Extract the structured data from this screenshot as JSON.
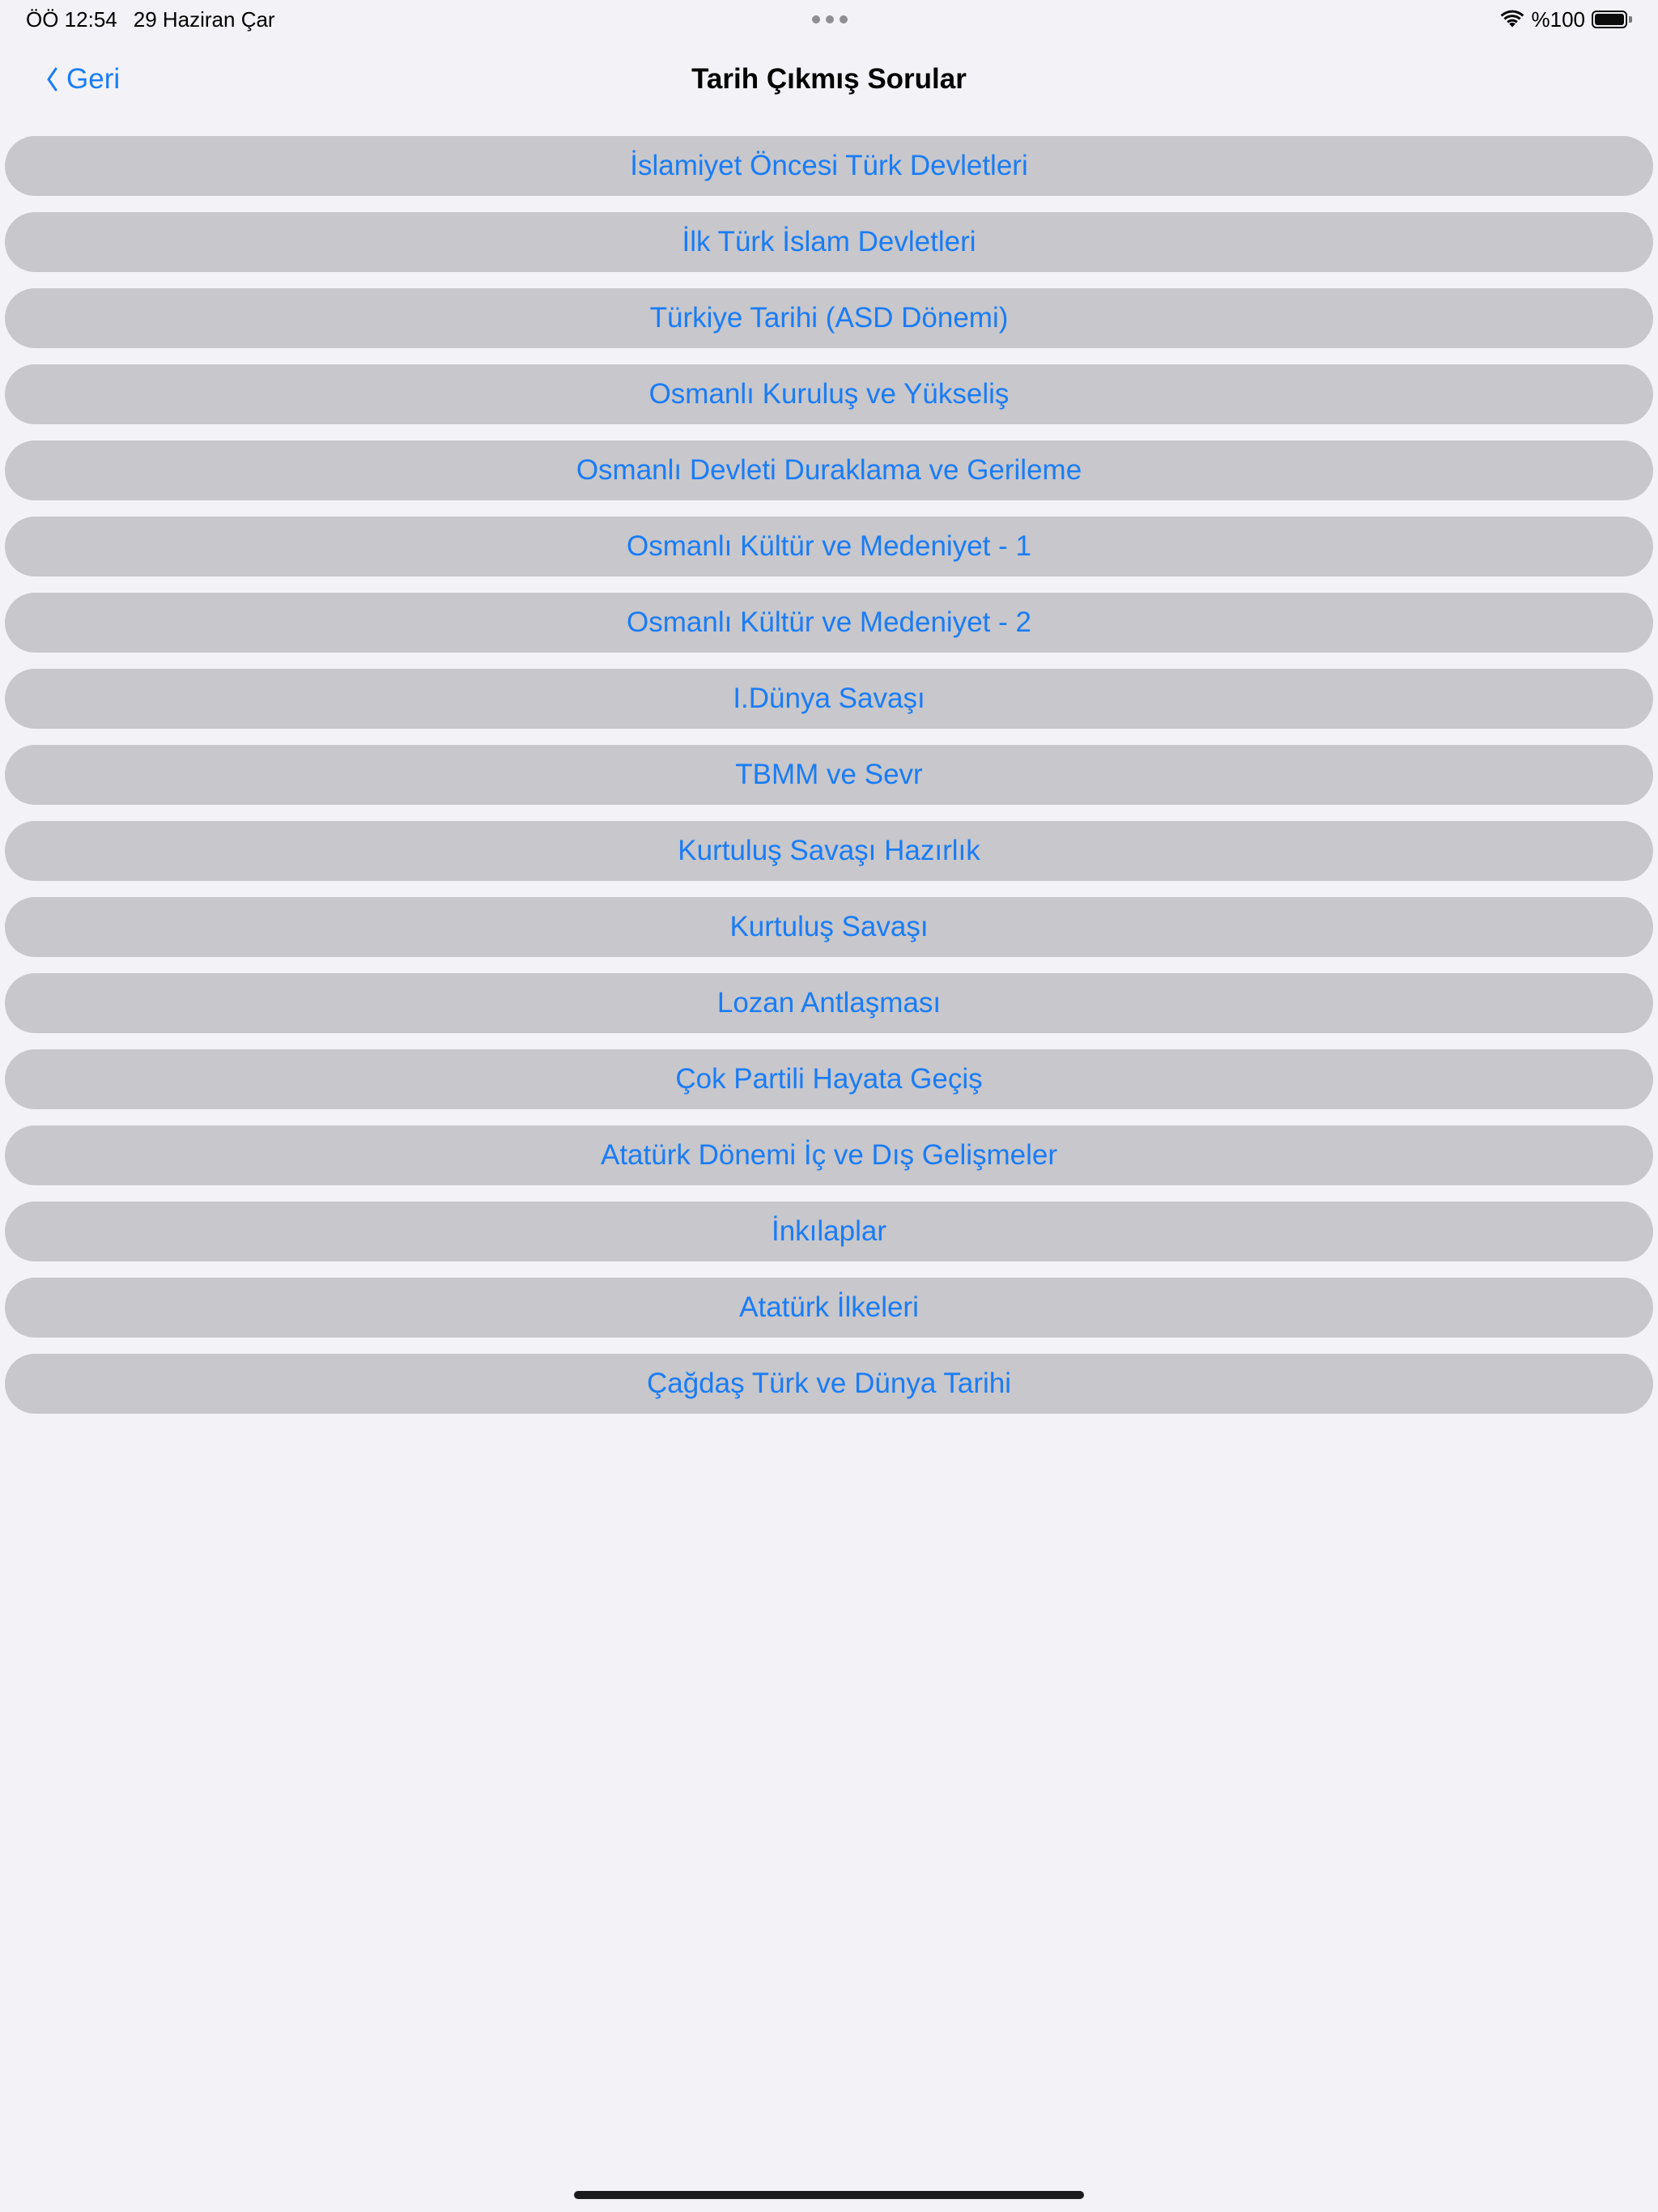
{
  "status_bar": {
    "time": "ÖÖ 12:54",
    "date": "29 Haziran Çar",
    "battery_percent": "%100",
    "battery_level": 1.0,
    "icons": [
      "wifi-icon",
      "battery-icon"
    ]
  },
  "nav": {
    "back_label": "Geri",
    "back_icon": "chevron-left-icon",
    "title": "Tarih Çıkmış Sorular"
  },
  "topics": [
    {
      "label": "İslamiyet Öncesi Türk Devletleri"
    },
    {
      "label": "İlk Türk İslam Devletleri"
    },
    {
      "label": "Türkiye Tarihi (ASD Dönemi)"
    },
    {
      "label": "Osmanlı Kuruluş ve Yükseliş"
    },
    {
      "label": "Osmanlı Devleti Duraklama ve Gerileme"
    },
    {
      "label": "Osmanlı Kültür ve Medeniyet - 1"
    },
    {
      "label": "Osmanlı Kültür ve Medeniyet - 2"
    },
    {
      "label": "I.Dünya Savaşı"
    },
    {
      "label": "TBMM ve Sevr"
    },
    {
      "label": "Kurtuluş Savaşı Hazırlık"
    },
    {
      "label": "Kurtuluş Savaşı"
    },
    {
      "label": "Lozan Antlaşması"
    },
    {
      "label": "Çok Partili Hayata Geçiş"
    },
    {
      "label": "Atatürk Dönemi İç ve Dış Gelişmeler"
    },
    {
      "label": "İnkılaplar"
    },
    {
      "label": "Atatürk İlkeleri"
    },
    {
      "label": "Çağdaş Türk ve Dünya Tarihi"
    }
  ],
  "colors": {
    "background": "#f2f2f7",
    "button_fill": "#c7c7cc",
    "accent_blue": "#1a7cf5",
    "text_primary": "#000000"
  }
}
